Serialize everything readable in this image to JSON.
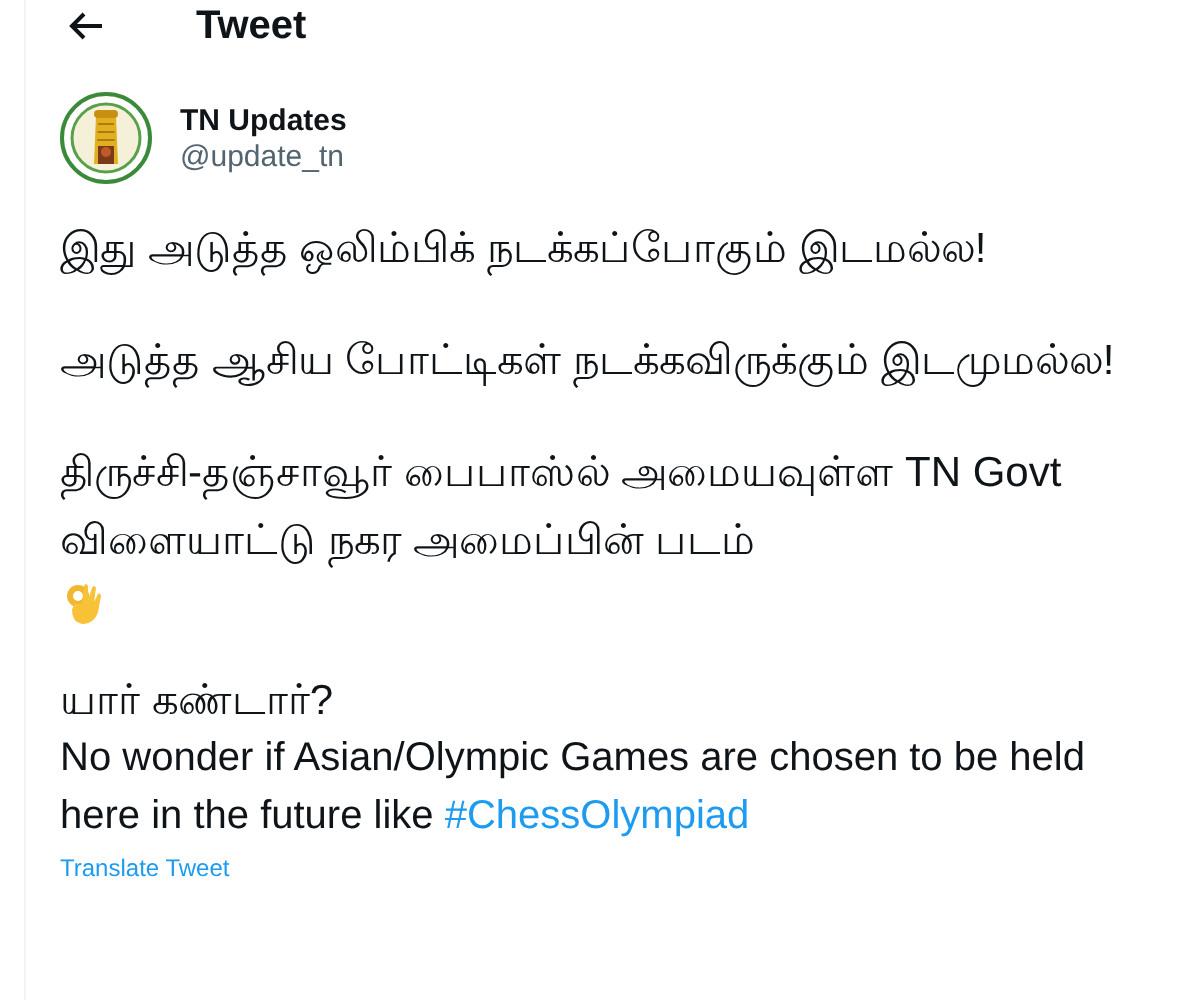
{
  "header": {
    "title": "Tweet"
  },
  "author": {
    "name": "TN Updates",
    "handle": "@update_tn"
  },
  "paragraphs": [
    {
      "lines": [
        {
          "text": "இது அடுத்த ஒலிம்பிக் நடக்கப்போகும் இடமல்ல!"
        }
      ]
    },
    {
      "lines": [
        {
          "text": "அடுத்த ஆசிய போட்டிகள் நடக்கவிருக்கும் இடமுமல்ல!"
        }
      ]
    },
    {
      "lines": [
        {
          "text": "திருச்சி-தஞ்சாவூர் பைபாஸ்ல் அமையவுள்ள TN Govt விளையாட்டு நகர அமைப்பின் படம்",
          "emoji": true
        }
      ]
    },
    {
      "lines": [
        {
          "text": "யார் கண்டார்?"
        },
        {
          "text": "No wonder if Asian/Olympic Games are chosen to be held here in the future like",
          "hashtag": "#ChessOlympiad"
        }
      ]
    }
  ],
  "translate": "Translate Tweet"
}
